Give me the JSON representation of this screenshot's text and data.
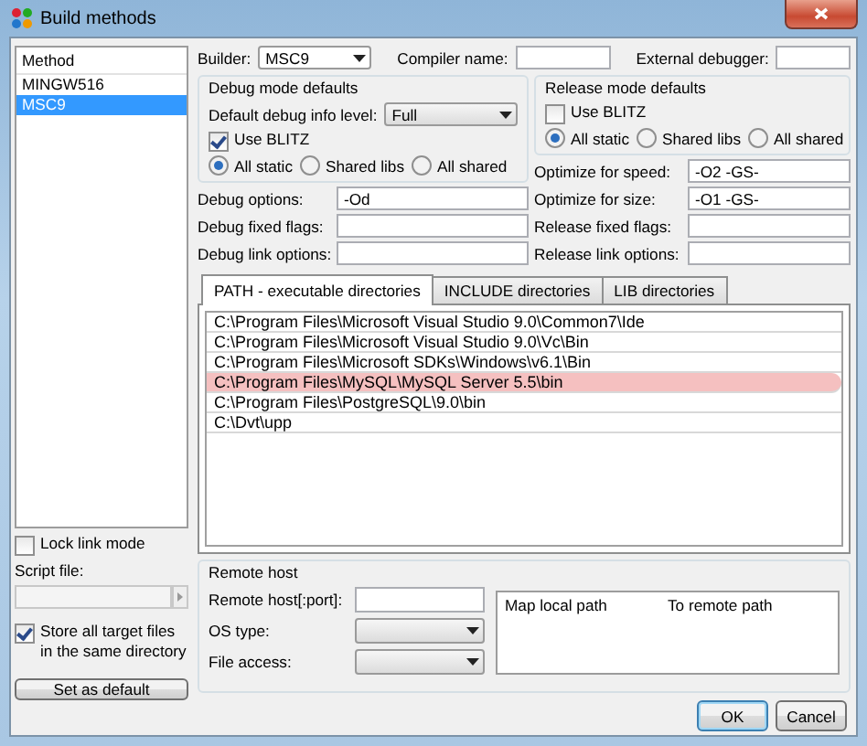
{
  "window": {
    "title": "Build methods"
  },
  "methods": {
    "header": "Method",
    "items": [
      {
        "label": "MINGW516",
        "selected": false
      },
      {
        "label": "MSC9",
        "selected": true
      }
    ]
  },
  "builder": {
    "label": "Builder:",
    "value": "MSC9"
  },
  "compiler_name": {
    "label": "Compiler name:"
  },
  "external_debugger": {
    "label": "External debugger:"
  },
  "debug_defaults": {
    "title": "Debug mode defaults",
    "info_level_label": "Default debug info level:",
    "info_level": "Full",
    "use_blitz": {
      "label": "Use BLITZ",
      "checked": true
    },
    "linking": [
      {
        "label": "All static",
        "selected": true
      },
      {
        "label": "Shared libs",
        "selected": false
      },
      {
        "label": "All shared",
        "selected": false
      }
    ]
  },
  "debug_options": [
    {
      "label": "Debug options:",
      "value": "-Od"
    },
    {
      "label": "Debug fixed flags:"
    },
    {
      "label": "Debug link options:"
    }
  ],
  "release_defaults": {
    "title": "Release mode defaults",
    "use_blitz": {
      "label": "Use BLITZ",
      "checked": false
    },
    "linking": [
      {
        "label": "All static",
        "selected": true
      },
      {
        "label": "Shared libs",
        "selected": false
      },
      {
        "label": "All shared",
        "selected": false
      }
    ]
  },
  "release_options": [
    {
      "label": "Optimize for speed:",
      "value": "-O2 -GS-"
    },
    {
      "label": "Optimize for size:",
      "value": "-O1 -GS-"
    },
    {
      "label": "Release fixed flags:"
    },
    {
      "label": "Release link options:"
    }
  ],
  "tabs": [
    {
      "label": "PATH - executable directories",
      "selected": true
    },
    {
      "label": "INCLUDE directories",
      "selected": false
    },
    {
      "label": "LIB directories",
      "selected": false
    }
  ],
  "paths": [
    {
      "text": "C:\\Program Files\\Microsoft Visual Studio 9.0\\Common7\\Ide",
      "highlighted": false
    },
    {
      "text": "C:\\Program Files\\Microsoft Visual Studio 9.0\\Vc\\Bin",
      "highlighted": false
    },
    {
      "text": "C:\\Program Files\\Microsoft SDKs\\Windows\\v6.1\\Bin",
      "highlighted": false
    },
    {
      "text": "C:\\Program Files\\MySQL\\MySQL Server 5.5\\bin",
      "highlighted": true
    },
    {
      "text": "C:\\Program Files\\PostgreSQL\\9.0\\bin",
      "highlighted": false
    },
    {
      "text": "C:\\Dvt\\upp",
      "highlighted": false
    }
  ],
  "lock_link_mode": {
    "label": "Lock link mode",
    "checked": false
  },
  "script_file": {
    "label": "Script file:",
    "disabled": true
  },
  "store_all": {
    "label": "Store all target files in the same directory",
    "checked": true
  },
  "set_default_button": "Set as default",
  "remote_host": {
    "title": "Remote host",
    "fields": [
      {
        "kind": "text",
        "label": "Remote host[:port]:"
      },
      {
        "kind": "combo",
        "label": "OS type:"
      },
      {
        "kind": "combo",
        "label": "File access:"
      }
    ],
    "map_columns": [
      "Map local path",
      "To remote path"
    ]
  },
  "buttons": [
    {
      "label": "OK",
      "default": true
    },
    {
      "label": "Cancel",
      "default": false
    }
  ]
}
